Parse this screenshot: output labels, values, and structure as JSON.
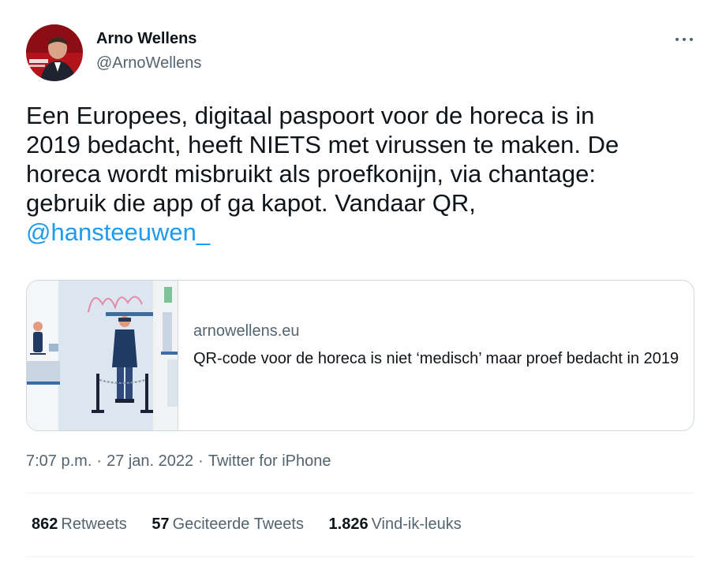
{
  "tweet": {
    "author": {
      "name": "Arno Wellens",
      "handle": "@ArnoWellens"
    },
    "text_lines": [
      "Een Europees, digitaal paspoort voor de horeca is in",
      "2019 bedacht, heeft NIETS met virussen te maken. De",
      "horeca wordt misbruikt als proefkonijn, via chantage:",
      "gebruik die app of ga kapot. Vandaar QR,"
    ],
    "mention": "@hansteeuwen_",
    "link_card": {
      "domain": "arnowellens.eu",
      "title": "QR-code voor de horeca is niet ‘medisch’ maar proef bedacht in 2019"
    },
    "time": "7:07 p.m.",
    "date": "27 jan. 2022",
    "source": "Twitter for iPhone",
    "separator": "·",
    "stats": {
      "retweets": {
        "count": "862",
        "label": "Retweets"
      },
      "quotes": {
        "count": "57",
        "label": "Geciteerde Tweets"
      },
      "likes": {
        "count": "1.826",
        "label": "Vind-ik-leuks"
      }
    },
    "icons": {
      "more": "more-dots-icon"
    },
    "colors": {
      "link": "#1d9bf0",
      "secondary_text": "#536471",
      "text": "#0f1419",
      "border": "#cfd9de"
    }
  }
}
